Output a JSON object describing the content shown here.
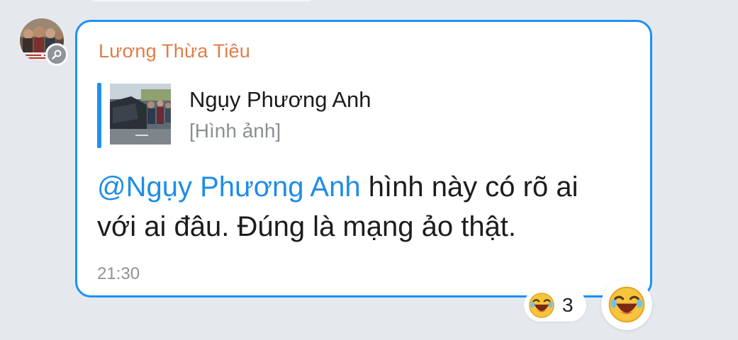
{
  "message": {
    "sender": "Lương Thừa Tiêu",
    "quote": {
      "name": "Ngụy Phương Anh",
      "type_label": "[Hình ảnh]"
    },
    "mention": "@Ngụy Phương Anh",
    "text_line1_rest": " hình này có rõ ai",
    "text_line2": "với ai đâu. Đúng là mạng ảo thật.",
    "time": "21:30"
  },
  "reactions": {
    "emoji": "laughing-emoji",
    "count": "3"
  },
  "colors": {
    "background": "#e5e9ee",
    "bubble_border": "#1e90f5",
    "sender_name": "#e07d48",
    "mention": "#1e8de8",
    "secondary_text": "#8e9298"
  }
}
